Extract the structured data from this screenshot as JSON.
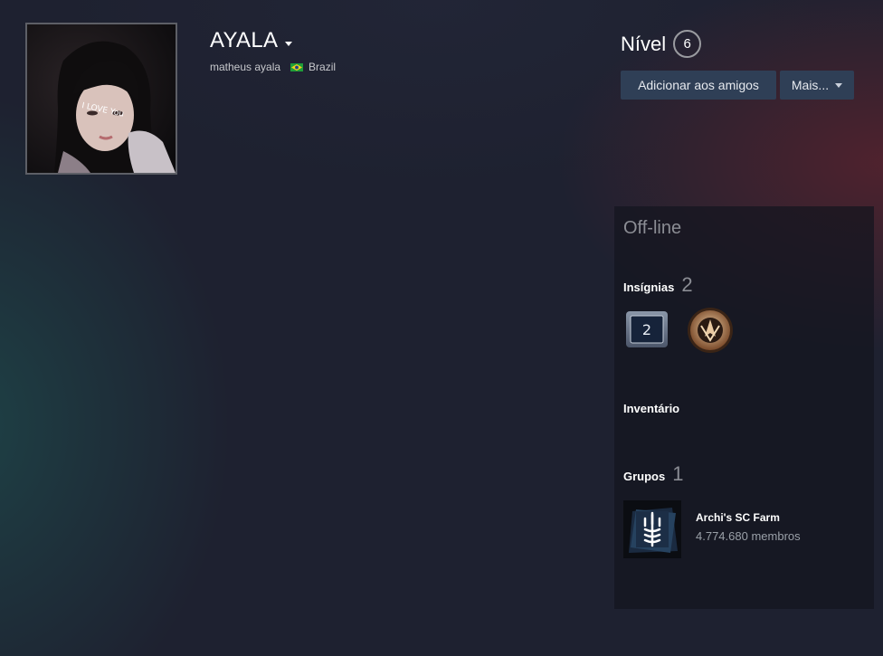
{
  "profile": {
    "persona_name": "AYALA",
    "real_name": "matheus ayala",
    "country": "Brazil",
    "avatar_text": "I LOVE You"
  },
  "level": {
    "label": "Nível",
    "value": "6"
  },
  "actions": {
    "add_friend": "Adicionar aos amigos",
    "more": "Mais..."
  },
  "sidebar": {
    "status": "Off-line",
    "badges": {
      "title": "Insígnias",
      "count": "2",
      "badge_value": "2"
    },
    "inventory": {
      "title": "Inventário"
    },
    "groups": {
      "title": "Grupos",
      "count": "1",
      "items": [
        {
          "name": "Archi's SC Farm",
          "members": "4.774.680 membros"
        }
      ]
    }
  },
  "colors": {
    "background": "#1e2130",
    "button": "#2f3f56",
    "muted_text": "#8b8d94",
    "panel": "#14151e"
  }
}
